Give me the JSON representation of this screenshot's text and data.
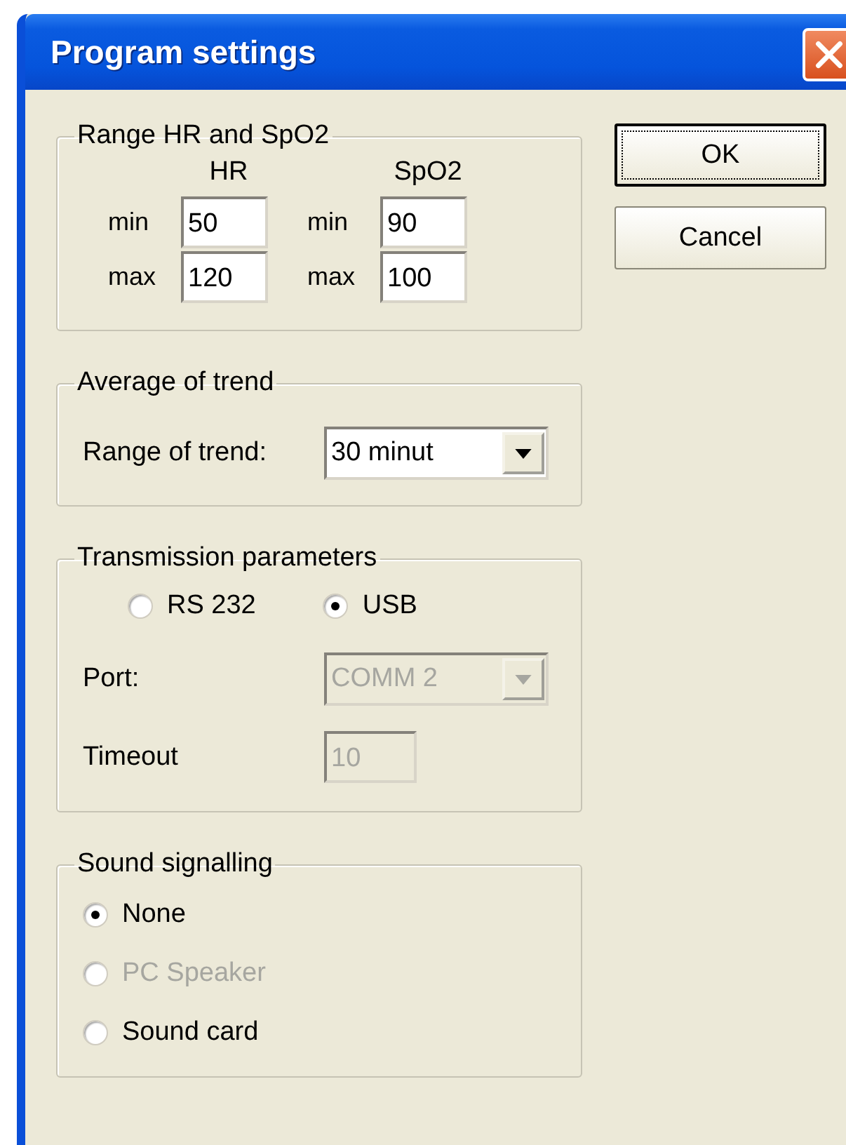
{
  "window": {
    "title": "Program settings"
  },
  "buttons": [
    {
      "label": "OK",
      "default": true
    },
    {
      "label": "Cancel",
      "default": false
    }
  ],
  "range": {
    "title": "Range HR and SpO2",
    "columns": [
      {
        "heading": "HR",
        "rows": [
          {
            "label": "min",
            "value": "50"
          },
          {
            "label": "max",
            "value": "120"
          }
        ]
      },
      {
        "heading": "SpO2",
        "rows": [
          {
            "label": "min",
            "value": "90"
          },
          {
            "label": "max",
            "value": "100"
          }
        ]
      }
    ]
  },
  "trend": {
    "title": "Average of trend",
    "label": "Range of trend:",
    "value": "30 minut"
  },
  "transmission": {
    "title": "Transmission parameters",
    "options": [
      {
        "label": "RS 232",
        "selected": false
      },
      {
        "label": "USB",
        "selected": true
      }
    ],
    "port": {
      "label": "Port:",
      "value": "COMM 2",
      "disabled": true
    },
    "timeout": {
      "label": "Timeout",
      "value": "10",
      "disabled": true
    }
  },
  "sound": {
    "title": "Sound signalling",
    "options": [
      {
        "label": "None",
        "selected": true,
        "disabled": false
      },
      {
        "label": "PC Speaker",
        "selected": false,
        "disabled": true
      },
      {
        "label": "Sound card",
        "selected": false,
        "disabled": false
      }
    ]
  }
}
